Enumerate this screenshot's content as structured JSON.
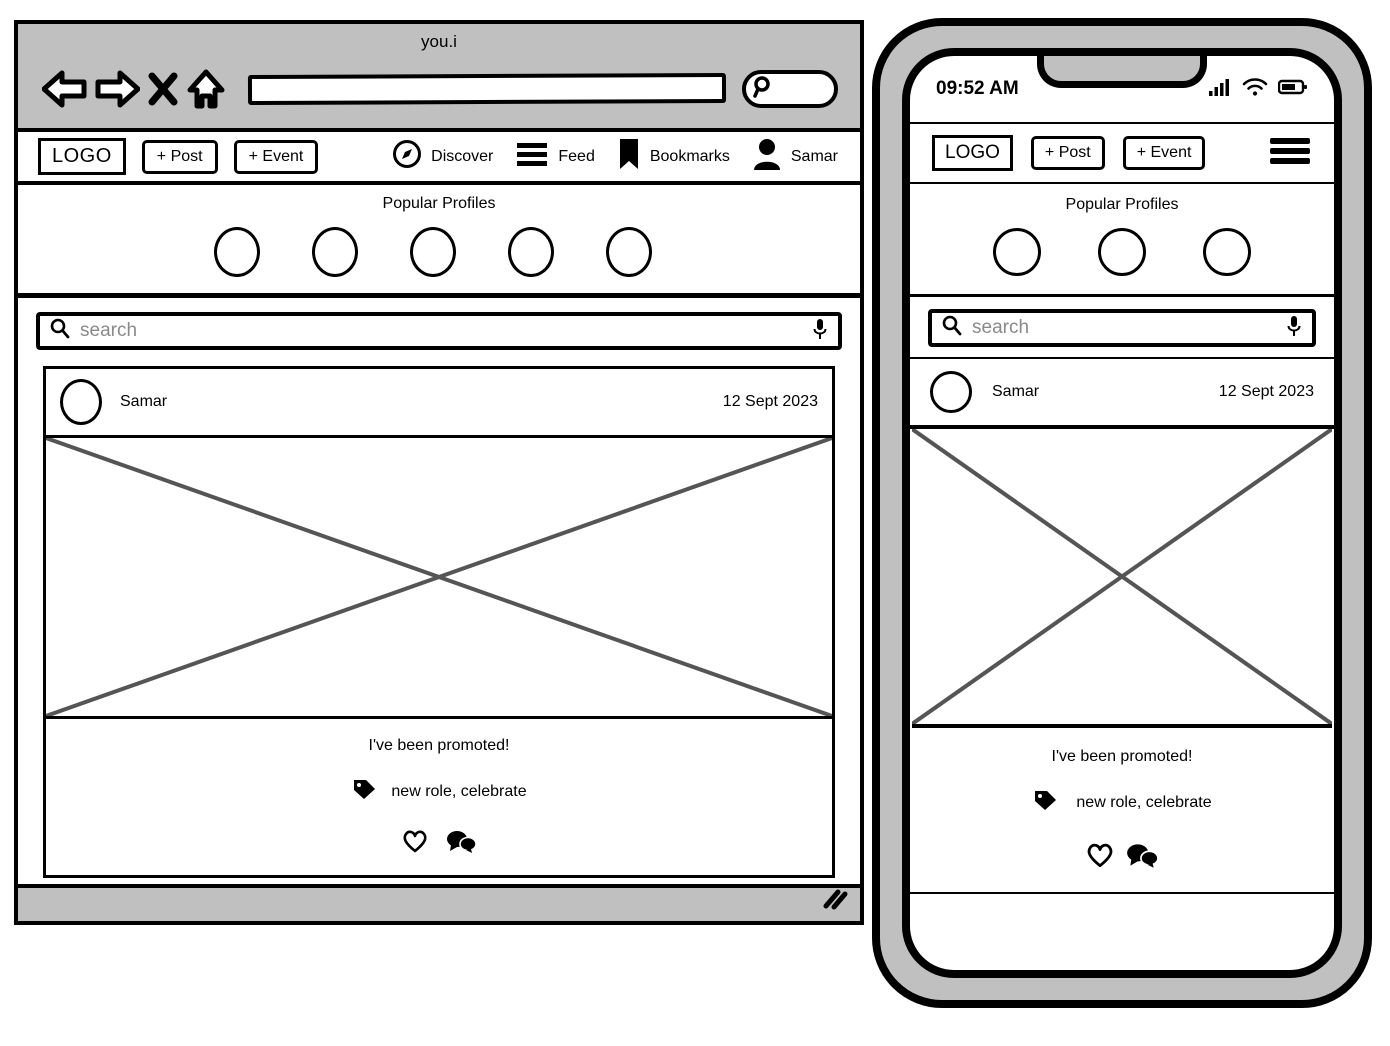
{
  "browser": {
    "title": "you.i",
    "url_value": "",
    "url_placeholder": "",
    "search_placeholder": "",
    "controls": [
      "back-arrow",
      "forward-arrow",
      "stop-x",
      "home"
    ]
  },
  "desktop": {
    "nav": {
      "logo": "LOGO",
      "post_button": "+ Post",
      "event_button": "+ Event",
      "links": [
        {
          "label": "Discover",
          "icon": "compass-icon"
        },
        {
          "label": "Feed",
          "icon": "hamburger-icon"
        },
        {
          "label": "Bookmarks",
          "icon": "bookmark-icon"
        },
        {
          "label": "Samar",
          "icon": "person-icon"
        }
      ]
    },
    "profiles": {
      "title": "Popular Profiles",
      "count": 5
    },
    "search": {
      "placeholder": "search",
      "value": "",
      "left_icon": "search-icon",
      "right_icon": "microphone-icon"
    },
    "post": {
      "author": "Samar",
      "date": "12 Sept 2023",
      "caption": "I've been promoted!",
      "tags": "new role, celebrate",
      "tag_icon": "tag-icon",
      "like_icon": "heart-icon",
      "comment_icon": "comment-icon",
      "image_placeholder": "image-placeholder"
    }
  },
  "mobile": {
    "status": {
      "time": "09:52 AM",
      "signal_icon": "signal-bars-icon",
      "wifi_icon": "wifi-icon",
      "battery_icon": "battery-icon"
    },
    "nav": {
      "logo": "LOGO",
      "post_button": "+ Post",
      "event_button": "+ Event",
      "menu_icon": "hamburger-menu-icon"
    },
    "profiles": {
      "title": "Popular Profiles",
      "count": 3
    },
    "search": {
      "placeholder": "search",
      "value": "",
      "left_icon": "search-icon",
      "right_icon": "microphone-icon"
    },
    "post": {
      "author": "Samar",
      "date": "12 Sept 2023",
      "caption": "I've been promoted!",
      "tags": "new role, celebrate",
      "tag_icon": "tag-icon",
      "like_icon": "heart-icon",
      "comment_icon": "comment-icon",
      "image_placeholder": "image-placeholder"
    }
  },
  "colors": {
    "chrome_grey": "#c0c0c0",
    "stroke": "#000000",
    "placeholder_grey": "#8a8a8a",
    "image_x_grey": "#555555"
  }
}
